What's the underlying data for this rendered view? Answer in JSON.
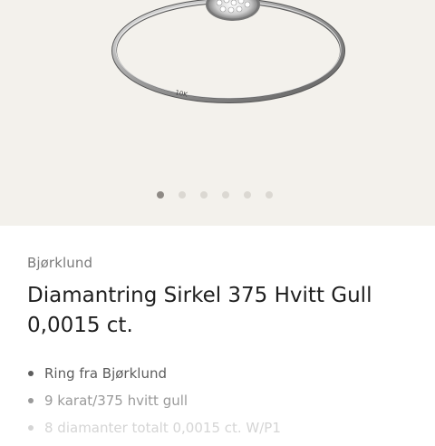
{
  "gallery": {
    "image_name": "ring-product-image",
    "engraving": "10K",
    "slide_count": 6,
    "active_slide": 1
  },
  "product": {
    "brand": "Bjørklund",
    "title": "Diamantring Sirkel 375 Hvitt Gull 0,0015 ct.",
    "features": [
      "Ring fra Bjørklund",
      "9 karat/375 hvitt gull",
      "8 diamanter totalt 0,0015 ct. W/P1"
    ]
  }
}
